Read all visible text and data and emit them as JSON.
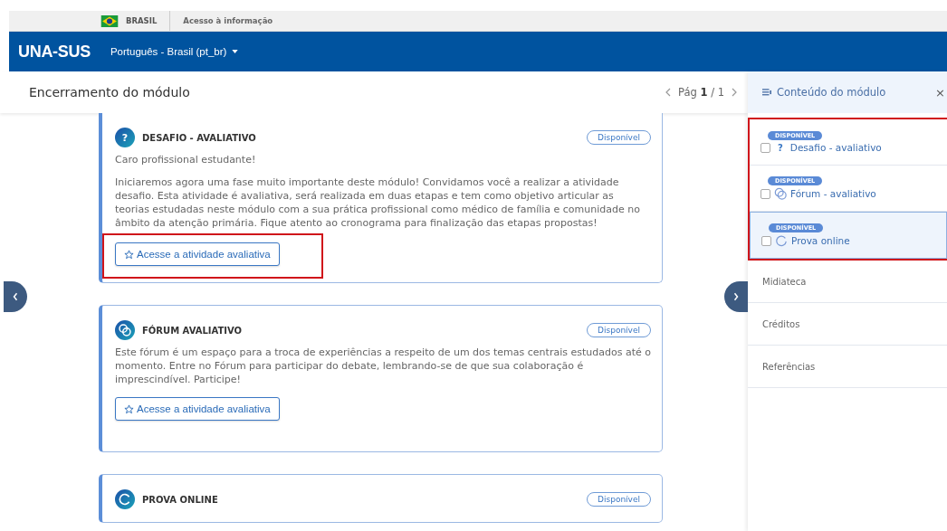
{
  "gov_bar": {
    "country": "BRASIL",
    "link": "Acesso à informação"
  },
  "header": {
    "logo": "UNA-SUS",
    "language": "Português - Brasil (pt_br)"
  },
  "page": {
    "title": "Encerramento do módulo",
    "pager": {
      "label": "Pág",
      "current": "1",
      "total": "/ 1"
    }
  },
  "cards": [
    {
      "kind": "desafio",
      "icon": "?",
      "title": "DESAFIO - AVALIATIVO",
      "status": "Disponível",
      "intro": "Caro profissional estudante!",
      "text": "Iniciaremos agora uma fase muito importante deste módulo! Convidamos você a realizar a atividade desafio. Esta atividade é avaliativa, será realizada em duas etapas e tem como objetivo articular as teorias estudadas neste módulo com a sua prática profissional como médico de família e comunidade no âmbito da atenção primária. Fique atento ao cronograma para finalização das etapas propostas!",
      "button": "Acesse a atividade avaliativa",
      "highlighted": true
    },
    {
      "kind": "forum",
      "title": "FÓRUM AVALIATIVO",
      "status": "Disponível",
      "text": "Este fórum é um espaço para a troca de experiências a respeito de um dos temas centrais estudados até o momento. Entre no Fórum para participar do debate, lembrando-se de que sua colaboração é imprescindível. Participe!",
      "button": "Acesse a atividade avaliativa",
      "highlighted": false
    },
    {
      "kind": "prova",
      "title": "PROVA ONLINE",
      "status": "Disponível"
    }
  ],
  "sidebar": {
    "title": "Conteúdo do módulo",
    "close": "×",
    "activities_highlighted": true,
    "activities": [
      {
        "kind": "desafio",
        "icon": "?",
        "badge": "DISPONÍVEL",
        "label": "Desafio - avaliativo",
        "checked": false,
        "selected": false
      },
      {
        "kind": "forum",
        "badge": "DISPONÍVEL",
        "label": "Fórum - avaliativo",
        "checked": false,
        "selected": false
      },
      {
        "kind": "prova",
        "badge": "DISPONÍVEL",
        "label": "Prova online",
        "checked": false,
        "selected": true
      }
    ],
    "sections": [
      "Midiateca",
      "Créditos",
      "Referências"
    ]
  }
}
